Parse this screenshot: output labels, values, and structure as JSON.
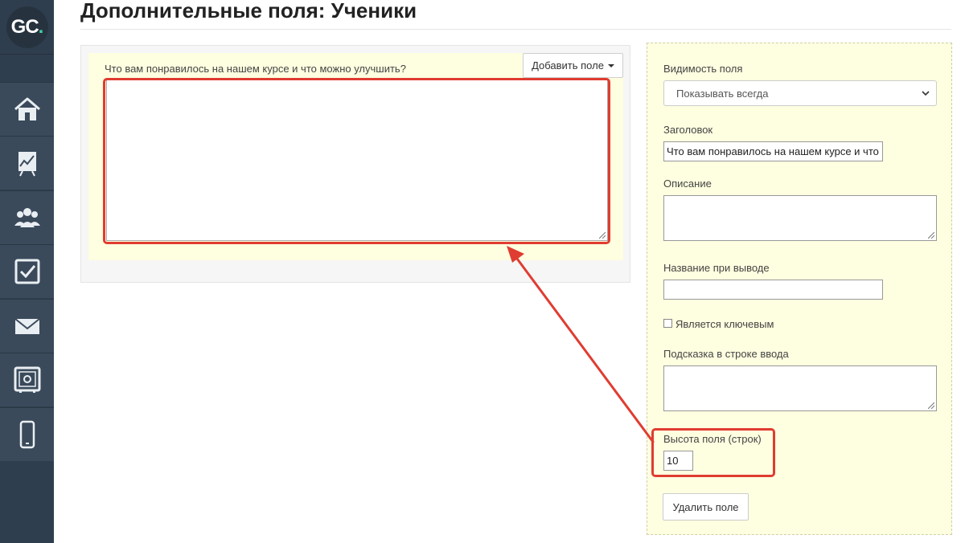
{
  "header": {
    "title": "Дополнительные поля: Ученики"
  },
  "logo": {
    "text_g": "G",
    "text_c": "C",
    "text_dot": "."
  },
  "sidebar": {
    "items": [
      {
        "icon": "home-icon"
      },
      {
        "icon": "analytics-chart-icon"
      },
      {
        "icon": "users-icon"
      },
      {
        "icon": "tasks-checkbox-icon"
      },
      {
        "icon": "mail-icon"
      },
      {
        "icon": "safe-icon"
      },
      {
        "icon": "mobile-icon"
      }
    ]
  },
  "editor": {
    "field_label": "Что вам понравилось на нашем курсе и что можно улучшить?",
    "add_field_label": "Добавить поле"
  },
  "settings": {
    "visibility_label": "Видимость поля",
    "visibility_value": "Показывать всегда",
    "title_label": "Заголовок",
    "title_value": "Что вам понравилось на нашем курсе и что",
    "description_label": "Описание",
    "output_name_label": "Название при выводе",
    "output_name_value": "",
    "key_checkbox_label": "Является ключевым",
    "placeholder_label": "Подсказка в строке ввода",
    "height_label": "Высота поля (строк)",
    "height_value": "10",
    "delete_label": "Удалить поле"
  },
  "colors": {
    "sidebar_bg": "#2f3e4e",
    "accent_green": "#3fd0a7",
    "highlight_red": "#e03c31",
    "field_bg": "#fefee0"
  }
}
